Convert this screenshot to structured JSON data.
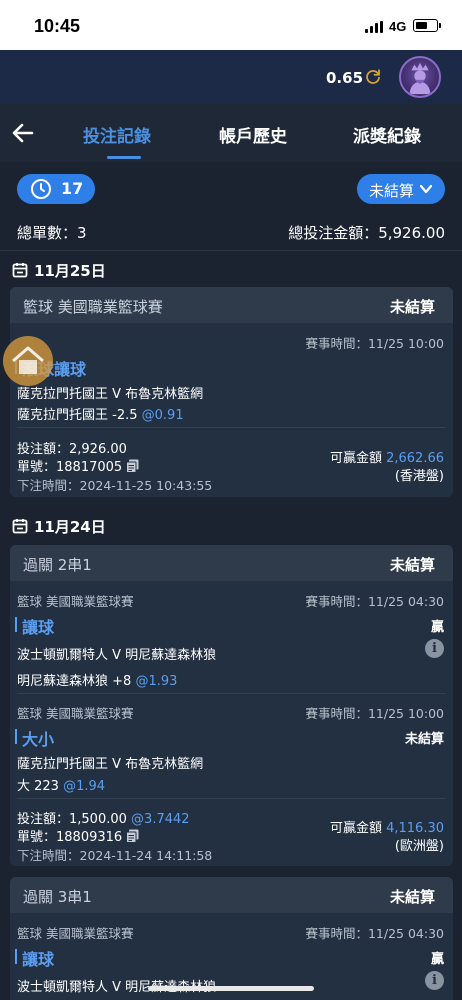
{
  "status_bar": {
    "time": "10:45",
    "network": "4G"
  },
  "header": {
    "balance": "0.65"
  },
  "nav": {
    "tabs": [
      {
        "label": "投注記錄"
      },
      {
        "label": "帳戶歷史"
      },
      {
        "label": "派獎紀錄"
      }
    ]
  },
  "filters": {
    "count": "17",
    "status": "未結算"
  },
  "summary": {
    "total_orders": "總單數：3",
    "total_stake": "總投注金額：5,926.00"
  },
  "groups": [
    {
      "date": "11月25日",
      "card": {
        "title": "籃球 美國職業籃球賽",
        "state": "未結算",
        "match_time": "賽事時間：11/25 10:00",
        "market": "滾球讓球",
        "teams": "薩克拉門托國王 V 布魯克林籃網",
        "selection": "薩克拉門托國王 -2.5",
        "odds": "@0.91",
        "stake": "投注額：2,926.00",
        "order_no": "單號：18817005",
        "placed_at": "下注時間：2024-11-25 10:43:55",
        "win_label": "可贏金額",
        "win_amount": "2,662.66",
        "odds_type": "(香港盤)"
      }
    },
    {
      "date": "11月24日",
      "card": {
        "title": "過關 2串1",
        "state": "未結算",
        "legs": [
          {
            "league": "籃球 美國職業籃球賽",
            "match_time": "賽事時間：11/25 04:30",
            "market": "讓球",
            "result": "贏",
            "teams": "波士頓凱爾特人 V 明尼蘇達森林狼",
            "selection": "明尼蘇達森林狼 +8",
            "odds": "@1.93"
          },
          {
            "league": "籃球 美國職業籃球賽",
            "match_time": "賽事時間：11/25 10:00",
            "market": "大小",
            "result": "未結算",
            "teams": "薩克拉門托國王 V 布魯克林籃網",
            "selection": "大 223",
            "odds": "@1.94"
          }
        ],
        "stake": "投注額：1,500.00",
        "stake_odds": "@3.7442",
        "order_no": "單號：18809316",
        "placed_at": "下注時間：2024-11-24 14:11:58",
        "win_label": "可贏金額",
        "win_amount": "4,116.30",
        "odds_type": "(歐洲盤)"
      }
    },
    {
      "card": {
        "title": "過關 3串1",
        "state": "未結算",
        "legs": [
          {
            "league": "籃球 美國職業籃球賽",
            "match_time": "賽事時間：11/25 04:30",
            "market": "讓球",
            "result": "贏",
            "teams": "波士頓凱爾特人 V 明尼蘇達森林狼"
          }
        ]
      }
    }
  ],
  "colors": {
    "accent": "#2e80e8",
    "link": "#5b9ef0",
    "background": "#1b2330",
    "header": "#1d2a47"
  }
}
